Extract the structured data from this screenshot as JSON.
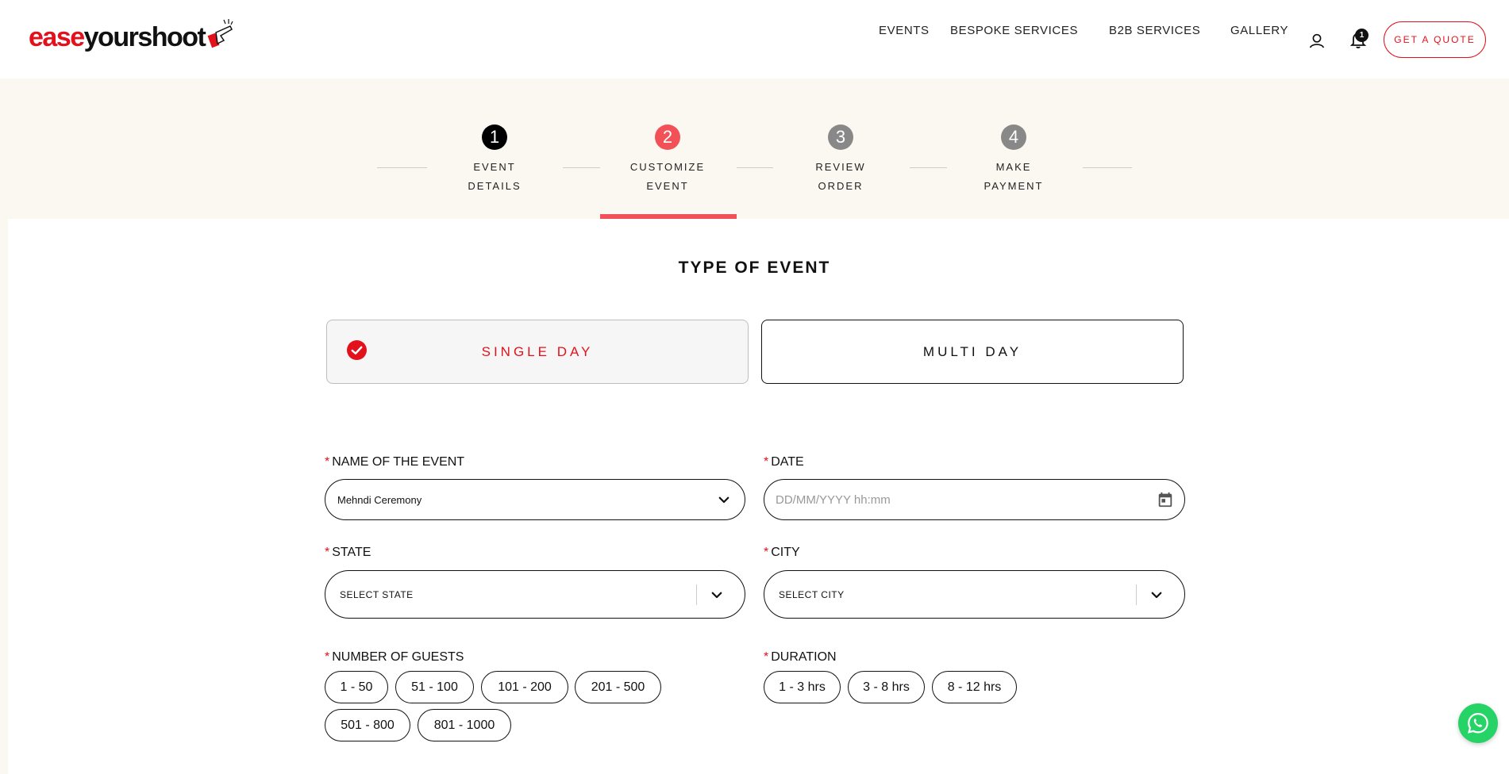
{
  "header": {
    "logo": {
      "part1": "ease",
      "part2": "yourshoot"
    },
    "nav": [
      {
        "label": "EVENTS"
      },
      {
        "label": "BESPOKE SERVICES"
      },
      {
        "label": "B2B SERVICES"
      },
      {
        "label": "GALLERY"
      }
    ],
    "user_icon": "user-icon",
    "bell_icon": "bell-icon",
    "notification_count": "1",
    "quote_button": "GET A QUOTE"
  },
  "stepper": {
    "steps": [
      {
        "number": "1",
        "line1": "EVENT",
        "line2": "DETAILS",
        "state": "done",
        "color": "#000000"
      },
      {
        "number": "2",
        "line1": "CUSTOMIZE",
        "line2": "EVENT",
        "state": "active",
        "color": "#f15157"
      },
      {
        "number": "3",
        "line1": "REVIEW",
        "line2": "ORDER",
        "state": "pending",
        "color": "#888888"
      },
      {
        "number": "4",
        "line1": "MAKE",
        "line2": "PAYMENT",
        "state": "pending",
        "color": "#888888"
      }
    ]
  },
  "form": {
    "title": "TYPE OF EVENT",
    "event_types": [
      {
        "label": "SINGLE DAY",
        "selected": true
      },
      {
        "label": "MULTI DAY",
        "selected": false
      }
    ],
    "name_label": "Name of the Event",
    "name_value": "Mehndi Ceremony",
    "date_label": "Date",
    "date_placeholder": "DD/MM/YYYY hh:mm",
    "state_label": "State",
    "state_value": "Select State",
    "city_label": "City",
    "city_value": "Select City",
    "guests_label": "Number of Guests",
    "guest_options": [
      "1 - 50",
      "51 - 100",
      "101 - 200",
      "201 - 500",
      "501 - 800",
      "801 - 1000"
    ],
    "duration_label": "Duration",
    "duration_options": [
      "1 - 3 hrs",
      "3 - 8 hrs",
      "8 - 12 hrs"
    ],
    "required_marker": "*"
  },
  "colors": {
    "brand_red": "#e3111b",
    "active_step": "#f15157",
    "whatsapp": "#25d366"
  }
}
